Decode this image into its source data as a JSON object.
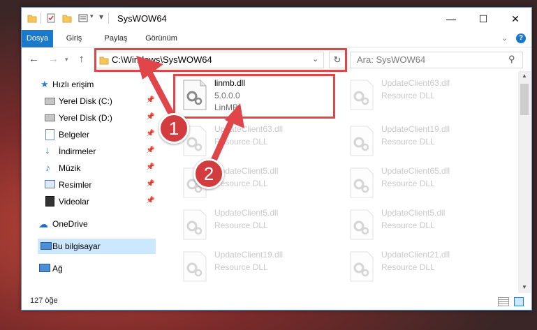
{
  "window": {
    "title": "SysWOW64",
    "controls": [
      "—",
      "☐",
      "✕"
    ]
  },
  "ribbon": {
    "tabs": [
      "Dosya",
      "Giriş",
      "Paylaş",
      "Görünüm"
    ],
    "help_icon": "?"
  },
  "navigation": {
    "address": "C:\\Windows\\SysWOW64",
    "search_placeholder": "Ara: SysWOW64"
  },
  "sidebar": {
    "items": [
      {
        "label": "Hızlı erişim",
        "icon": "star-icon"
      },
      {
        "label": "Yerel Disk (C:)",
        "icon": "drive-icon",
        "pinned": true
      },
      {
        "label": "Yerel Disk (D:)",
        "icon": "drive-icon",
        "pinned": true
      },
      {
        "label": "Belgeler",
        "icon": "document-icon",
        "pinned": true
      },
      {
        "label": "İndirmeler",
        "icon": "download-icon",
        "pinned": true
      },
      {
        "label": "Müzik",
        "icon": "music-icon",
        "pinned": true
      },
      {
        "label": "Resimler",
        "icon": "pictures-icon",
        "pinned": true
      },
      {
        "label": "Videolar",
        "icon": "video-icon",
        "pinned": true
      },
      {
        "label": "OneDrive",
        "icon": "cloud-icon"
      },
      {
        "label": "Bu bilgisayar",
        "icon": "computer-icon"
      },
      {
        "label": "Ağ",
        "icon": "network-icon"
      }
    ]
  },
  "files": [
    {
      "name": "linmb.dll",
      "line2": "5.0.0.0",
      "line3": "LinMB"
    },
    {
      "name": "UpdateClient63.dll",
      "line2": "Resource DLL"
    },
    {
      "name": "UpdateClient63.dll",
      "line2": "Resource DLL"
    },
    {
      "name": "UpdateClient19.dll",
      "line2": "Resource DLL"
    },
    {
      "name": "UpdateClient5.dll",
      "line2": "Resource DLL"
    },
    {
      "name": "UpdateClient65.dll",
      "line2": "Resource DLL"
    },
    {
      "name": "UpdateClient5.dll",
      "line2": "Resource DLL"
    },
    {
      "name": "UpdateClient5.dll",
      "line2": "Resource DLL"
    },
    {
      "name": "UpdateClient19.dll",
      "line2": "Resource DLL"
    },
    {
      "name": "UpdateClient21.dll",
      "line2": "Resource DLL"
    }
  ],
  "status": {
    "item_count": "127 öğe"
  },
  "annotations": {
    "step1": "1",
    "step2": "2",
    "color": "#e0454a"
  }
}
